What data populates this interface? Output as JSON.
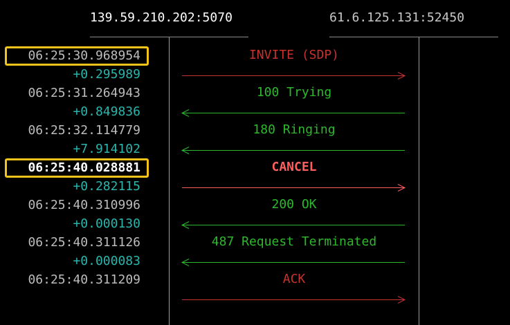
{
  "header": {
    "left_endpoint": "139.59.210.202:5070",
    "right_endpoint": "61.6.125.131:52450"
  },
  "colors": {
    "request": "#c8322e",
    "cancel": "#ff5e5e",
    "response": "#2eb82e",
    "delta": "#2ab5ad",
    "highlight_box": "#f2c318"
  },
  "messages": [
    {
      "timestamp": "06:25:30.968954",
      "delta": "+0.295989",
      "label": "INVITE (SDP)",
      "direction": "right",
      "kind": "request",
      "highlighted": true
    },
    {
      "timestamp": "06:25:31.264943",
      "delta": "+0.849836",
      "label": "100 Trying",
      "direction": "left",
      "kind": "response",
      "highlighted": false
    },
    {
      "timestamp": "06:25:32.114779",
      "delta": "+7.914102",
      "label": "180 Ringing",
      "direction": "left",
      "kind": "response",
      "highlighted": false
    },
    {
      "timestamp": "06:25:40.028881",
      "delta": "+0.282115",
      "label": "CANCEL",
      "direction": "right",
      "kind": "cancel",
      "highlighted": true
    },
    {
      "timestamp": "06:25:40.310996",
      "delta": "+0.000130",
      "label": "200 OK",
      "direction": "left",
      "kind": "response",
      "highlighted": false
    },
    {
      "timestamp": "06:25:40.311126",
      "delta": "+0.000083",
      "label": "487 Request Terminated",
      "direction": "left",
      "kind": "response",
      "highlighted": false
    },
    {
      "timestamp": "06:25:40.311209",
      "delta": "",
      "label": "ACK",
      "direction": "right",
      "kind": "request",
      "highlighted": false
    }
  ]
}
